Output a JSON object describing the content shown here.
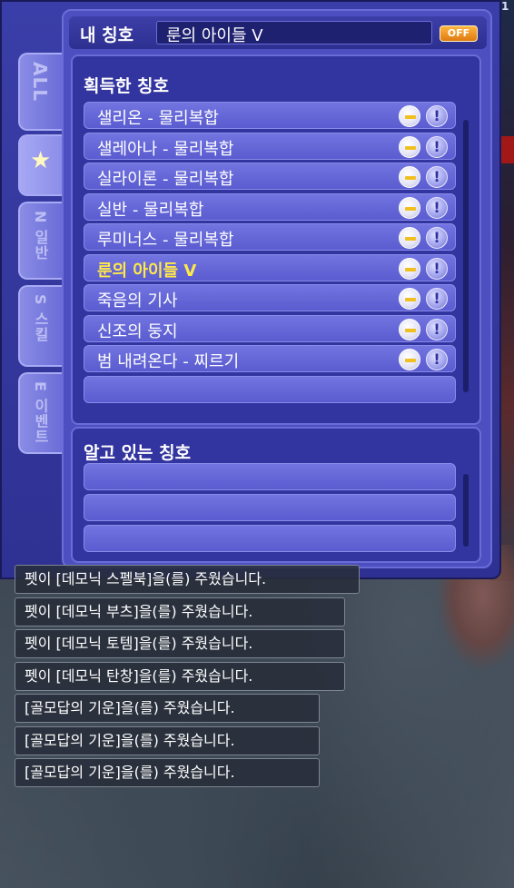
{
  "hud": {
    "top_right_number": "1"
  },
  "window": {
    "title_label": "내 칭호",
    "current_title": "룬의 아이들 Ⅴ",
    "off_button": "OFF"
  },
  "tabs": [
    {
      "id": "all",
      "label": "ALL"
    },
    {
      "id": "favorites",
      "icon": "star-icon"
    },
    {
      "id": "normal",
      "letter": "N",
      "label": "일반"
    },
    {
      "id": "skill",
      "letter": "S",
      "label": "스킬"
    },
    {
      "id": "event",
      "letter": "E",
      "label": "이벤트"
    }
  ],
  "acquired": {
    "heading": "획득한 칭호",
    "items": [
      {
        "label": "샐리온 - 물리복합",
        "selected": false
      },
      {
        "label": "샐레아나 - 물리복합",
        "selected": false
      },
      {
        "label": "실라이론 - 물리복합",
        "selected": false
      },
      {
        "label": "실반 - 물리복합",
        "selected": false
      },
      {
        "label": "루미너스 - 물리복합",
        "selected": false
      },
      {
        "label": "룬의 아이들 Ⅴ",
        "selected": true
      },
      {
        "label": "죽음의 기사",
        "selected": false
      },
      {
        "label": "신조의 둥지",
        "selected": false
      },
      {
        "label": "범 내려온다 - 찌르기",
        "selected": false
      },
      {
        "label": "",
        "selected": false
      }
    ]
  },
  "known": {
    "heading": "알고 있는 칭호",
    "items": [
      "",
      "",
      ""
    ]
  },
  "chat": [
    "펫이 [데모닉 스펠북]을(를) 주웠습니다.",
    "펫이 [데모닉 부츠]을(를) 주웠습니다.",
    "펫이 [데모닉 토템]을(를) 주웠습니다.",
    "펫이 [데모닉 탄창]을(를) 주웠습니다.",
    "[골모답의 기운]을(를) 주웠습니다.",
    "[골모답의 기운]을(를) 주웠습니다.",
    "[골모답의 기운]을(를) 주웠습니다."
  ]
}
